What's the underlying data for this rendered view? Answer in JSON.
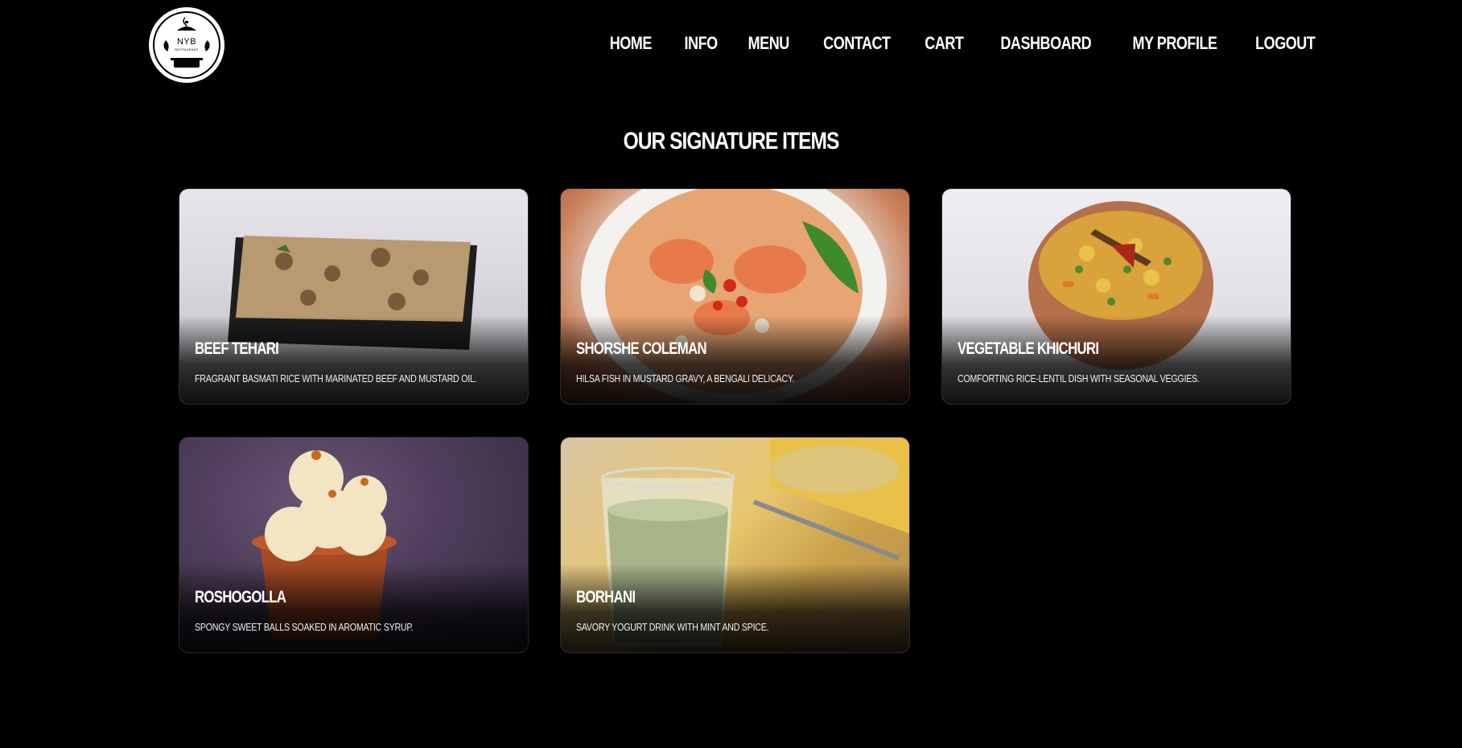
{
  "brand": {
    "logo_text": "NYB",
    "logo_subtext": "RESTAURANT"
  },
  "nav": {
    "items": [
      {
        "label": "HOME"
      },
      {
        "label": "INFO"
      },
      {
        "label": "MENU"
      },
      {
        "label": "CONTACT"
      },
      {
        "label": "CART"
      },
      {
        "label": "DASHBOARD"
      },
      {
        "label": "MY PROFILE"
      },
      {
        "label": "LOGOUT"
      }
    ]
  },
  "section": {
    "title": "OUR SIGNATURE ITEMS"
  },
  "items": [
    {
      "name": "BEEF TEHARI",
      "description": "FRAGRANT BASMATI RICE WITH MARINATED BEEF AND MUSTARD OIL."
    },
    {
      "name": "SHORSHE COLEMAN",
      "description": "HILSA FISH IN MUSTARD GRAVY, A BENGALI DELICACY."
    },
    {
      "name": "VEGETABLE KHICHURI",
      "description": "COMFORTING RICE-LENTIL DISH WITH SEASONAL VEGGIES."
    },
    {
      "name": "ROSHOGOLLA",
      "description": "SPONGY SWEET BALLS SOAKED IN AROMATIC SYRUP."
    },
    {
      "name": "BORHANI",
      "description": "SAVORY YOGURT DRINK WITH MINT AND SPICE."
    }
  ],
  "colors": {
    "background": "#000000",
    "text": "#ffffff"
  }
}
